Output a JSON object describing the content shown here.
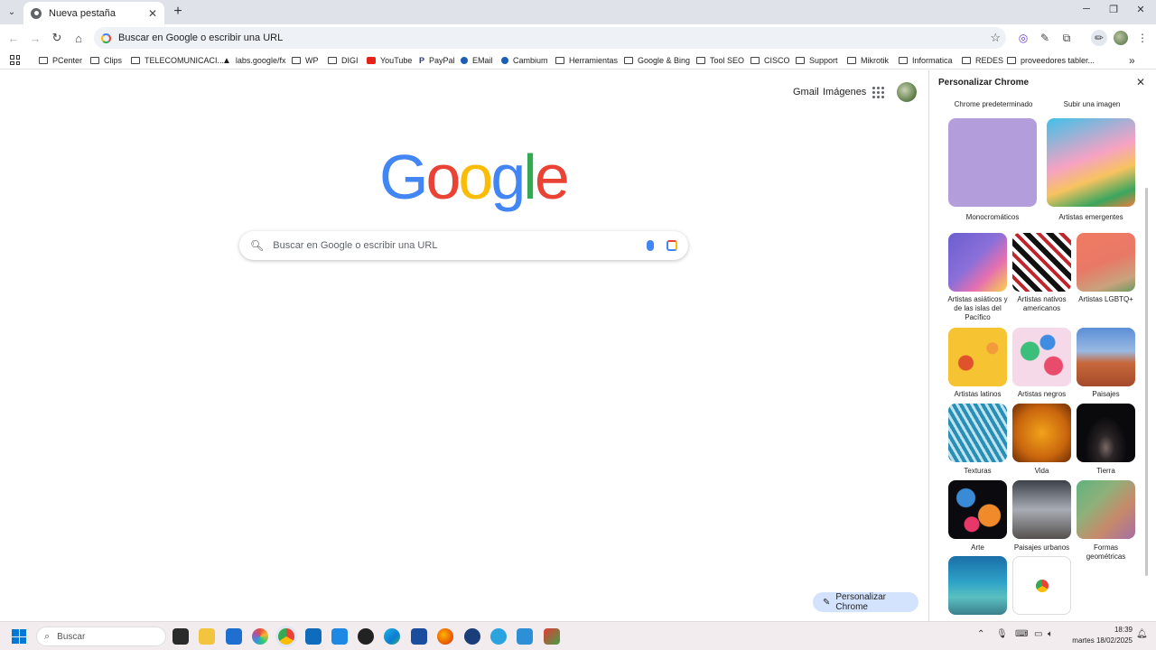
{
  "tab": {
    "title": "Nueva pestaña"
  },
  "window_controls": {
    "minimize": "─",
    "maximize": "❐",
    "close": "✕"
  },
  "omnibox": {
    "text": "Buscar en Google o escribir una URL"
  },
  "bookmarks": [
    {
      "label": "PCenter",
      "icon": "folder-icon"
    },
    {
      "label": "Clips",
      "icon": "folder-icon"
    },
    {
      "label": "TELECOMUNICACI...",
      "icon": "folder-icon"
    },
    {
      "label": "labs.google/fx",
      "icon": "labs-icon"
    },
    {
      "label": "WP",
      "icon": "folder-icon"
    },
    {
      "label": "DIGI",
      "icon": "folder-icon"
    },
    {
      "label": "YouTube",
      "icon": "youtube-icon"
    },
    {
      "label": "PayPal",
      "icon": "paypal-icon"
    },
    {
      "label": "EMail",
      "icon": "email-icon"
    },
    {
      "label": "Cambium",
      "icon": "cambium-icon"
    },
    {
      "label": "Herramientas",
      "icon": "folder-icon"
    },
    {
      "label": "Google & Bing",
      "icon": "folder-icon"
    },
    {
      "label": "Tool SEO",
      "icon": "folder-icon"
    },
    {
      "label": "CISCO",
      "icon": "folder-icon"
    },
    {
      "label": "Support",
      "icon": "folder-icon"
    },
    {
      "label": "Mikrotik",
      "icon": "folder-icon"
    },
    {
      "label": "Informatica",
      "icon": "folder-icon"
    },
    {
      "label": "REDES",
      "icon": "folder-icon"
    },
    {
      "label": "proveedores tabler...",
      "icon": "folder-icon"
    }
  ],
  "header_links": {
    "gmail": "Gmail",
    "images": "Imágenes"
  },
  "logo": {
    "letters": [
      "G",
      "o",
      "o",
      "g",
      "l",
      "e"
    ],
    "colors": [
      "#4285f4",
      "#ea4335",
      "#fbbc05",
      "#4285f4",
      "#34a853",
      "#ea4335"
    ]
  },
  "search": {
    "placeholder": "Buscar en Google o escribir una URL"
  },
  "customize_button": {
    "label": "Personalizar Chrome"
  },
  "panel": {
    "title": "Personalizar Chrome",
    "top_options": [
      "Chrome predeterminado",
      "Subir una imagen"
    ],
    "collections": [
      "Monocromáticos",
      "Artistas emergentes",
      "Artistas asiáticos y de las islas del Pacífico",
      "Artistas nativos americanos",
      "Artistas LGBTQ+",
      "Artistas latinos",
      "Artistas negros",
      "Paisajes",
      "Texturas",
      "Vida",
      "Tierra",
      "Arte",
      "Paisajes urbanos",
      "Formas geométricas"
    ]
  },
  "taskbar": {
    "search_placeholder": "Buscar",
    "time": "18:39",
    "date": "martes 18/02/2025"
  }
}
